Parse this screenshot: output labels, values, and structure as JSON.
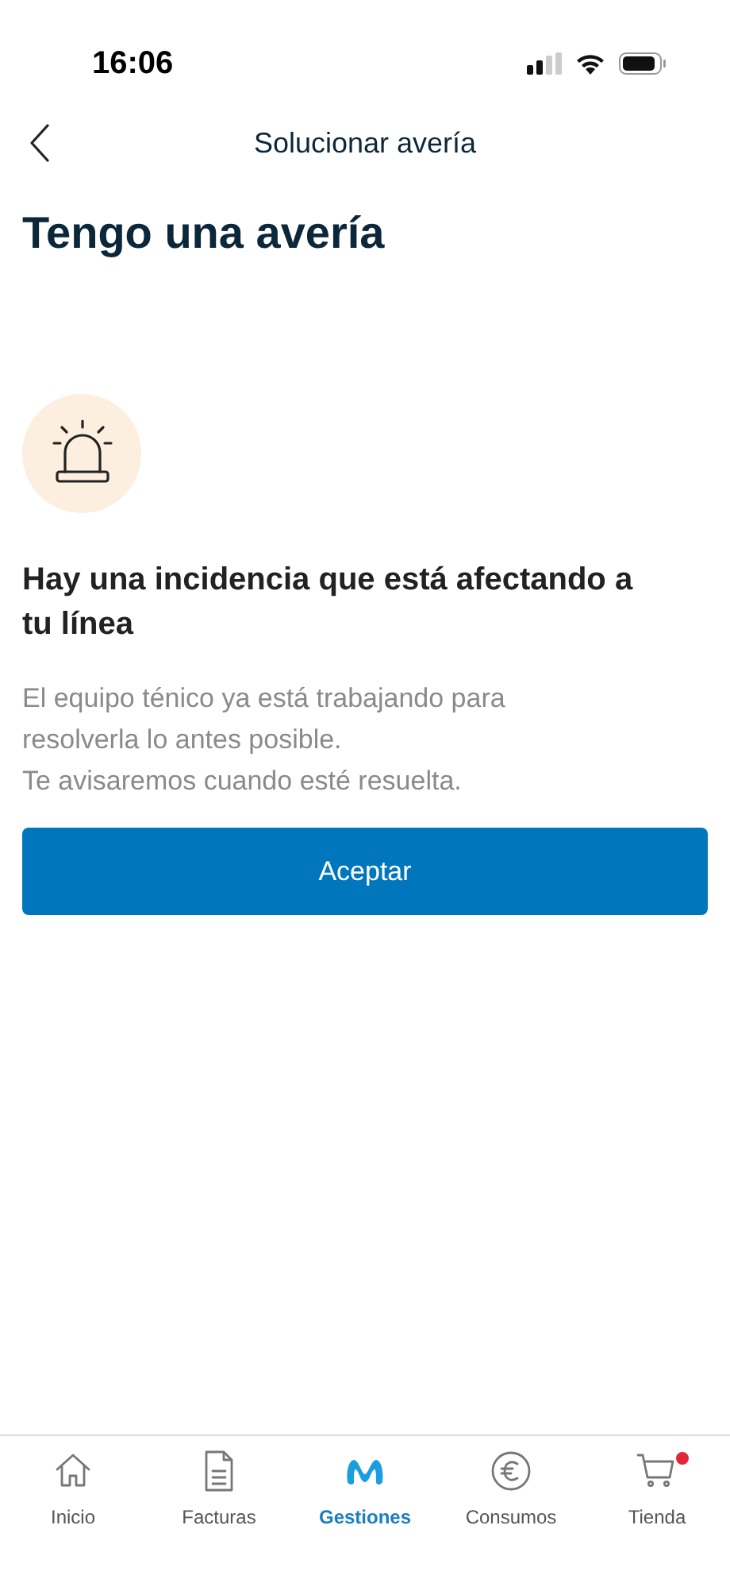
{
  "status_bar": {
    "time": "16:06"
  },
  "nav": {
    "title": "Solucionar avería"
  },
  "heading": "Tengo una avería",
  "notice": {
    "title": "Hay una incidencia que está afectando a tu línea",
    "body": [
      "El equipo ténico ya está trabajando para resolverla lo antes posible.",
      "Te avisaremos cuando esté resuelta."
    ]
  },
  "button": "Aceptar",
  "tab_bar": [
    {
      "kind": "home",
      "label": "Inicio",
      "selected": false,
      "badge": false
    },
    {
      "kind": "document",
      "label": "Facturas",
      "selected": false,
      "badge": false
    },
    {
      "kind": "logo",
      "label": "Gestiones",
      "selected": true,
      "badge": false
    },
    {
      "kind": "euro",
      "label": "Consumos",
      "selected": false,
      "badge": false
    },
    {
      "kind": "cart",
      "label": "Tienda",
      "selected": false,
      "badge": true
    }
  ]
}
